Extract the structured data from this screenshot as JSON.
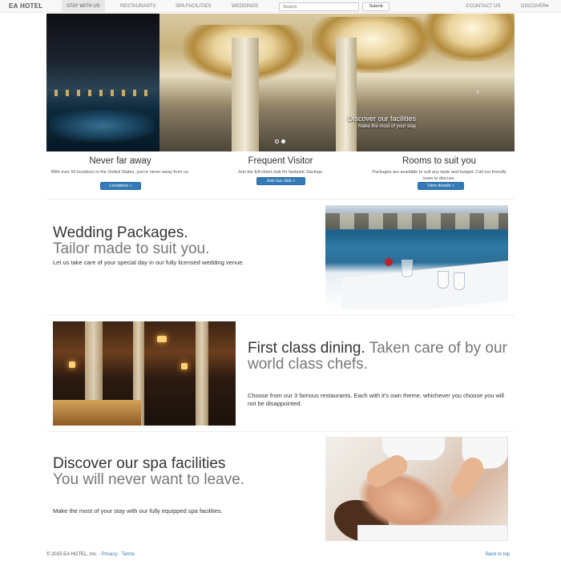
{
  "navbar": {
    "brand": "EA HOTEL",
    "items": [
      {
        "label": "STAY WITH US"
      },
      {
        "label": "RESTAURANTS"
      },
      {
        "label": "SPA FACILITIES"
      },
      {
        "label": "WEDDINGS"
      }
    ],
    "search_placeholder": "Search",
    "submit_label": "Submit",
    "contact_label": "CONTACT US",
    "discover_label": "DISCOVER",
    "contact_icon": "phone-icon",
    "discover_icon": "caret-down-icon"
  },
  "carousel": {
    "caption_title": "Discover our facilities",
    "caption_sub": "Make the most of your stay",
    "active_slide": 2,
    "slide_count": 2
  },
  "columns": [
    {
      "title": "Never far away",
      "text": "With over 50 locations in the United States, you're never away from us.",
      "button": "Locations »"
    },
    {
      "title": "Frequent Visitor",
      "text": "Join the EA Hotel club for fantastic Savings.",
      "button": "Join our club »"
    },
    {
      "title": "Rooms to suit you",
      "text": "Packages are available to suit any taste and budget. Call our friendly team to discuss.",
      "button": "View details »"
    }
  ],
  "featurettes": [
    {
      "heading": "Wedding Packages.",
      "muted": "Tailor made to suit you.",
      "lead": "Let us take care of your special day in our fully licensed wedding venue."
    },
    {
      "heading": "First class dining.",
      "muted": "Taken care of by our world class chefs.",
      "lead": "Choose from our 3 famous restaurants. Each with it's own theme, whichever you choose you will not be disappointed."
    },
    {
      "heading": "Discover our spa facilities",
      "muted": "You will never want to leave.",
      "lead": "Make the most of your stay with our fully equipped spa facilities."
    }
  ],
  "footer": {
    "copyright": "© 2015 EA HOTEL, Inc. ·",
    "privacy": "Privacy",
    "separator": "·",
    "terms": "Terms",
    "back_to_top": "Back to top"
  },
  "colors": {
    "primary_button": "#337ab7",
    "navbar_bg": "#f8f8f8",
    "muted_heading": "#777777"
  }
}
